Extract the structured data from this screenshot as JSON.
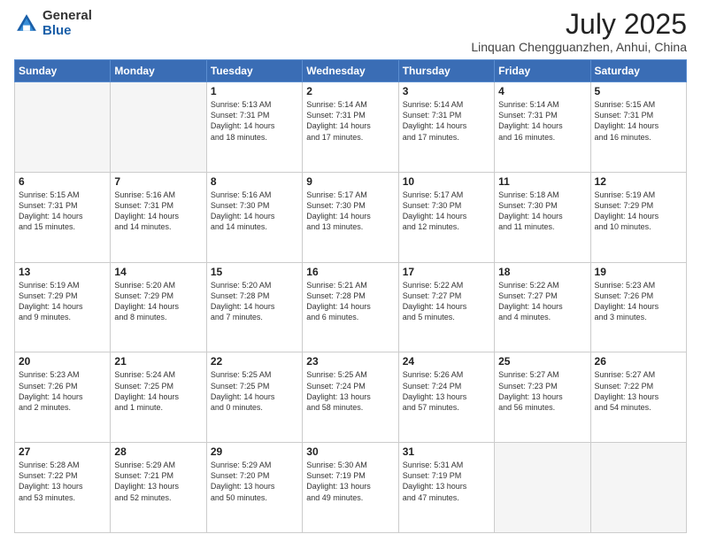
{
  "header": {
    "logo": {
      "general": "General",
      "blue": "Blue"
    },
    "title": "July 2025",
    "location": "Linquan Chengguanzhen, Anhui, China"
  },
  "calendar": {
    "days_of_week": [
      "Sunday",
      "Monday",
      "Tuesday",
      "Wednesday",
      "Thursday",
      "Friday",
      "Saturday"
    ],
    "weeks": [
      [
        {
          "day": "",
          "empty": true
        },
        {
          "day": "",
          "empty": true
        },
        {
          "day": "1",
          "line1": "Sunrise: 5:13 AM",
          "line2": "Sunset: 7:31 PM",
          "line3": "Daylight: 14 hours",
          "line4": "and 18 minutes."
        },
        {
          "day": "2",
          "line1": "Sunrise: 5:14 AM",
          "line2": "Sunset: 7:31 PM",
          "line3": "Daylight: 14 hours",
          "line4": "and 17 minutes."
        },
        {
          "day": "3",
          "line1": "Sunrise: 5:14 AM",
          "line2": "Sunset: 7:31 PM",
          "line3": "Daylight: 14 hours",
          "line4": "and 17 minutes."
        },
        {
          "day": "4",
          "line1": "Sunrise: 5:14 AM",
          "line2": "Sunset: 7:31 PM",
          "line3": "Daylight: 14 hours",
          "line4": "and 16 minutes."
        },
        {
          "day": "5",
          "line1": "Sunrise: 5:15 AM",
          "line2": "Sunset: 7:31 PM",
          "line3": "Daylight: 14 hours",
          "line4": "and 16 minutes."
        }
      ],
      [
        {
          "day": "6",
          "line1": "Sunrise: 5:15 AM",
          "line2": "Sunset: 7:31 PM",
          "line3": "Daylight: 14 hours",
          "line4": "and 15 minutes."
        },
        {
          "day": "7",
          "line1": "Sunrise: 5:16 AM",
          "line2": "Sunset: 7:31 PM",
          "line3": "Daylight: 14 hours",
          "line4": "and 14 minutes."
        },
        {
          "day": "8",
          "line1": "Sunrise: 5:16 AM",
          "line2": "Sunset: 7:30 PM",
          "line3": "Daylight: 14 hours",
          "line4": "and 14 minutes."
        },
        {
          "day": "9",
          "line1": "Sunrise: 5:17 AM",
          "line2": "Sunset: 7:30 PM",
          "line3": "Daylight: 14 hours",
          "line4": "and 13 minutes."
        },
        {
          "day": "10",
          "line1": "Sunrise: 5:17 AM",
          "line2": "Sunset: 7:30 PM",
          "line3": "Daylight: 14 hours",
          "line4": "and 12 minutes."
        },
        {
          "day": "11",
          "line1": "Sunrise: 5:18 AM",
          "line2": "Sunset: 7:30 PM",
          "line3": "Daylight: 14 hours",
          "line4": "and 11 minutes."
        },
        {
          "day": "12",
          "line1": "Sunrise: 5:19 AM",
          "line2": "Sunset: 7:29 PM",
          "line3": "Daylight: 14 hours",
          "line4": "and 10 minutes."
        }
      ],
      [
        {
          "day": "13",
          "line1": "Sunrise: 5:19 AM",
          "line2": "Sunset: 7:29 PM",
          "line3": "Daylight: 14 hours",
          "line4": "and 9 minutes."
        },
        {
          "day": "14",
          "line1": "Sunrise: 5:20 AM",
          "line2": "Sunset: 7:29 PM",
          "line3": "Daylight: 14 hours",
          "line4": "and 8 minutes."
        },
        {
          "day": "15",
          "line1": "Sunrise: 5:20 AM",
          "line2": "Sunset: 7:28 PM",
          "line3": "Daylight: 14 hours",
          "line4": "and 7 minutes."
        },
        {
          "day": "16",
          "line1": "Sunrise: 5:21 AM",
          "line2": "Sunset: 7:28 PM",
          "line3": "Daylight: 14 hours",
          "line4": "and 6 minutes."
        },
        {
          "day": "17",
          "line1": "Sunrise: 5:22 AM",
          "line2": "Sunset: 7:27 PM",
          "line3": "Daylight: 14 hours",
          "line4": "and 5 minutes."
        },
        {
          "day": "18",
          "line1": "Sunrise: 5:22 AM",
          "line2": "Sunset: 7:27 PM",
          "line3": "Daylight: 14 hours",
          "line4": "and 4 minutes."
        },
        {
          "day": "19",
          "line1": "Sunrise: 5:23 AM",
          "line2": "Sunset: 7:26 PM",
          "line3": "Daylight: 14 hours",
          "line4": "and 3 minutes."
        }
      ],
      [
        {
          "day": "20",
          "line1": "Sunrise: 5:23 AM",
          "line2": "Sunset: 7:26 PM",
          "line3": "Daylight: 14 hours",
          "line4": "and 2 minutes."
        },
        {
          "day": "21",
          "line1": "Sunrise: 5:24 AM",
          "line2": "Sunset: 7:25 PM",
          "line3": "Daylight: 14 hours",
          "line4": "and 1 minute."
        },
        {
          "day": "22",
          "line1": "Sunrise: 5:25 AM",
          "line2": "Sunset: 7:25 PM",
          "line3": "Daylight: 14 hours",
          "line4": "and 0 minutes."
        },
        {
          "day": "23",
          "line1": "Sunrise: 5:25 AM",
          "line2": "Sunset: 7:24 PM",
          "line3": "Daylight: 13 hours",
          "line4": "and 58 minutes."
        },
        {
          "day": "24",
          "line1": "Sunrise: 5:26 AM",
          "line2": "Sunset: 7:24 PM",
          "line3": "Daylight: 13 hours",
          "line4": "and 57 minutes."
        },
        {
          "day": "25",
          "line1": "Sunrise: 5:27 AM",
          "line2": "Sunset: 7:23 PM",
          "line3": "Daylight: 13 hours",
          "line4": "and 56 minutes."
        },
        {
          "day": "26",
          "line1": "Sunrise: 5:27 AM",
          "line2": "Sunset: 7:22 PM",
          "line3": "Daylight: 13 hours",
          "line4": "and 54 minutes."
        }
      ],
      [
        {
          "day": "27",
          "line1": "Sunrise: 5:28 AM",
          "line2": "Sunset: 7:22 PM",
          "line3": "Daylight: 13 hours",
          "line4": "and 53 minutes."
        },
        {
          "day": "28",
          "line1": "Sunrise: 5:29 AM",
          "line2": "Sunset: 7:21 PM",
          "line3": "Daylight: 13 hours",
          "line4": "and 52 minutes."
        },
        {
          "day": "29",
          "line1": "Sunrise: 5:29 AM",
          "line2": "Sunset: 7:20 PM",
          "line3": "Daylight: 13 hours",
          "line4": "and 50 minutes."
        },
        {
          "day": "30",
          "line1": "Sunrise: 5:30 AM",
          "line2": "Sunset: 7:19 PM",
          "line3": "Daylight: 13 hours",
          "line4": "and 49 minutes."
        },
        {
          "day": "31",
          "line1": "Sunrise: 5:31 AM",
          "line2": "Sunset: 7:19 PM",
          "line3": "Daylight: 13 hours",
          "line4": "and 47 minutes."
        },
        {
          "day": "",
          "empty": true
        },
        {
          "day": "",
          "empty": true
        }
      ]
    ]
  }
}
